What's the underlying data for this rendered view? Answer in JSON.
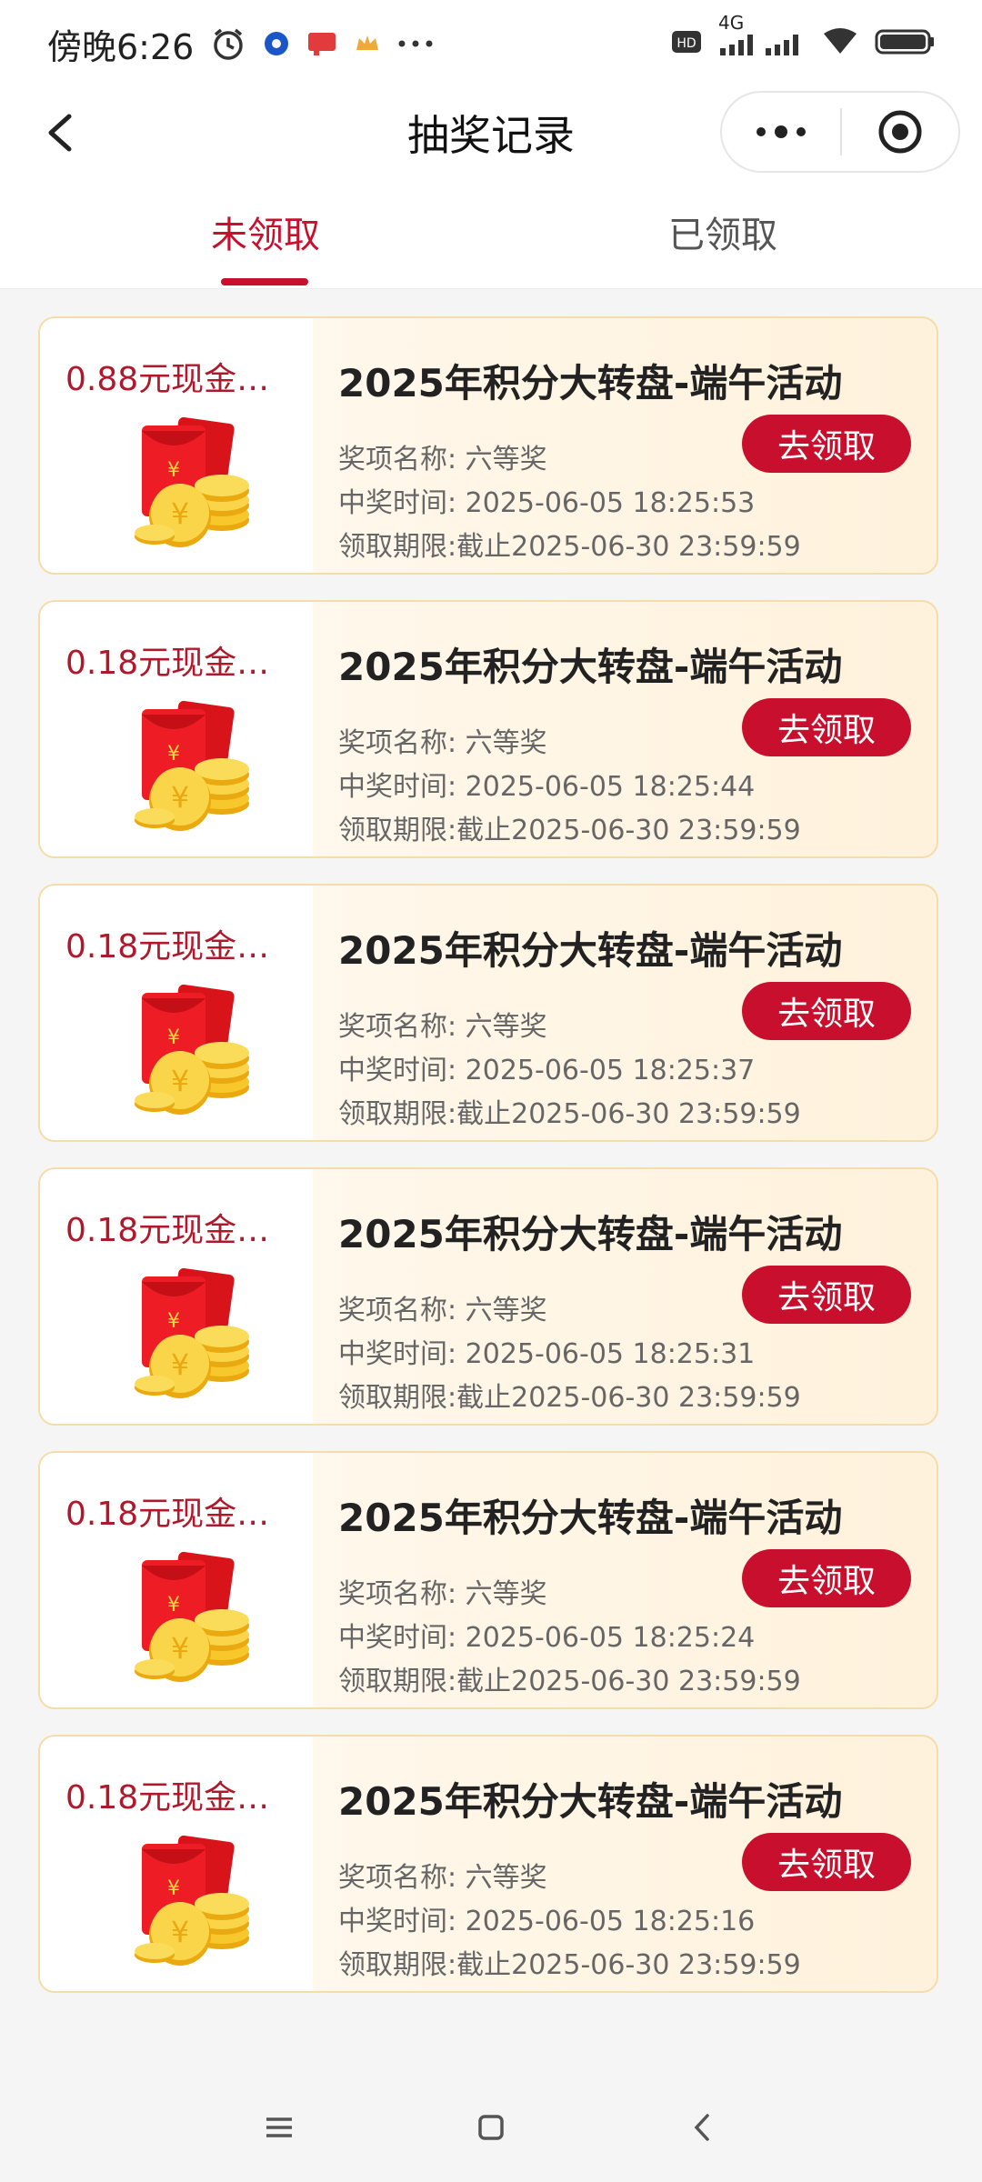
{
  "status_bar": {
    "time": "傍晚6:26",
    "network": "4G",
    "icons": [
      "alarm-icon",
      "app-blue-icon",
      "app-red-icon",
      "crown-icon",
      "more-dots-icon",
      "hd-icon",
      "signal-icon",
      "wifi-icon",
      "battery-icon"
    ]
  },
  "nav": {
    "title": "抽奖记录"
  },
  "tabs": [
    {
      "label": "未领取",
      "active": true
    },
    {
      "label": "已领取",
      "active": false
    }
  ],
  "records": [
    {
      "amount": "0.88元现金…",
      "title": "2025年积分大转盘-端午活动",
      "prize_name": "奖项名称: 六等奖",
      "win_time": "中奖时间: 2025-06-05 18:25:53",
      "deadline": "领取期限:截止2025-06-30 23:59:59",
      "button": "去领取"
    },
    {
      "amount": "0.18元现金…",
      "title": "2025年积分大转盘-端午活动",
      "prize_name": "奖项名称: 六等奖",
      "win_time": "中奖时间: 2025-06-05 18:25:44",
      "deadline": "领取期限:截止2025-06-30 23:59:59",
      "button": "去领取"
    },
    {
      "amount": "0.18元现金…",
      "title": "2025年积分大转盘-端午活动",
      "prize_name": "奖项名称: 六等奖",
      "win_time": "中奖时间: 2025-06-05 18:25:37",
      "deadline": "领取期限:截止2025-06-30 23:59:59",
      "button": "去领取"
    },
    {
      "amount": "0.18元现金…",
      "title": "2025年积分大转盘-端午活动",
      "prize_name": "奖项名称: 六等奖",
      "win_time": "中奖时间: 2025-06-05 18:25:31",
      "deadline": "领取期限:截止2025-06-30 23:59:59",
      "button": "去领取"
    },
    {
      "amount": "0.18元现金…",
      "title": "2025年积分大转盘-端午活动",
      "prize_name": "奖项名称: 六等奖",
      "win_time": "中奖时间: 2025-06-05 18:25:24",
      "deadline": "领取期限:截止2025-06-30 23:59:59",
      "button": "去领取"
    },
    {
      "amount": "0.18元现金…",
      "title": "2025年积分大转盘-端午活动",
      "prize_name": "奖项名称: 六等奖",
      "win_time": "中奖时间: 2025-06-05 18:25:16",
      "deadline": "领取期限:截止2025-06-30 23:59:59",
      "button": "去领取"
    }
  ],
  "colors": {
    "accent": "#c8102e",
    "card_border": "#f6dca6",
    "amount_text": "#b0182b"
  }
}
